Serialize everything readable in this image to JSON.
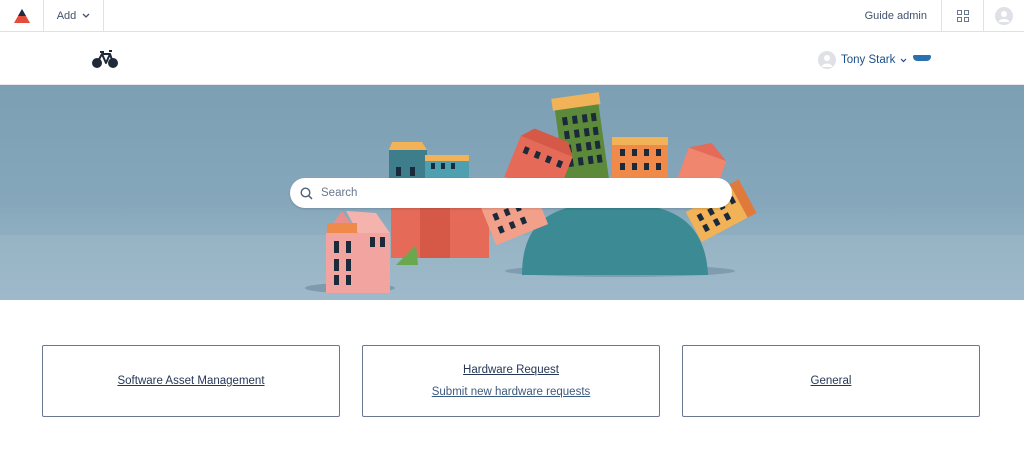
{
  "adminbar": {
    "logo_icon": "atlassian-triangle-icon",
    "add_label": "Add",
    "guide_label": "Guide admin",
    "apps_icon": "grid-icon",
    "profile_icon": "user-avatar-icon"
  },
  "portal": {
    "brand_icon": "bicycle-icon",
    "user_name": "Tony Stark",
    "user_caret": "⌄"
  },
  "search": {
    "placeholder": "Search"
  },
  "cards": [
    {
      "title": "Software Asset Management",
      "description": ""
    },
    {
      "title": "Hardware Request",
      "description": "Submit new hardware requests"
    },
    {
      "title": "General",
      "description": ""
    }
  ],
  "colors": {
    "accent": "#1d4e89",
    "hero_sky": "#7c9fb4",
    "logo_red": "#e34c3b"
  }
}
